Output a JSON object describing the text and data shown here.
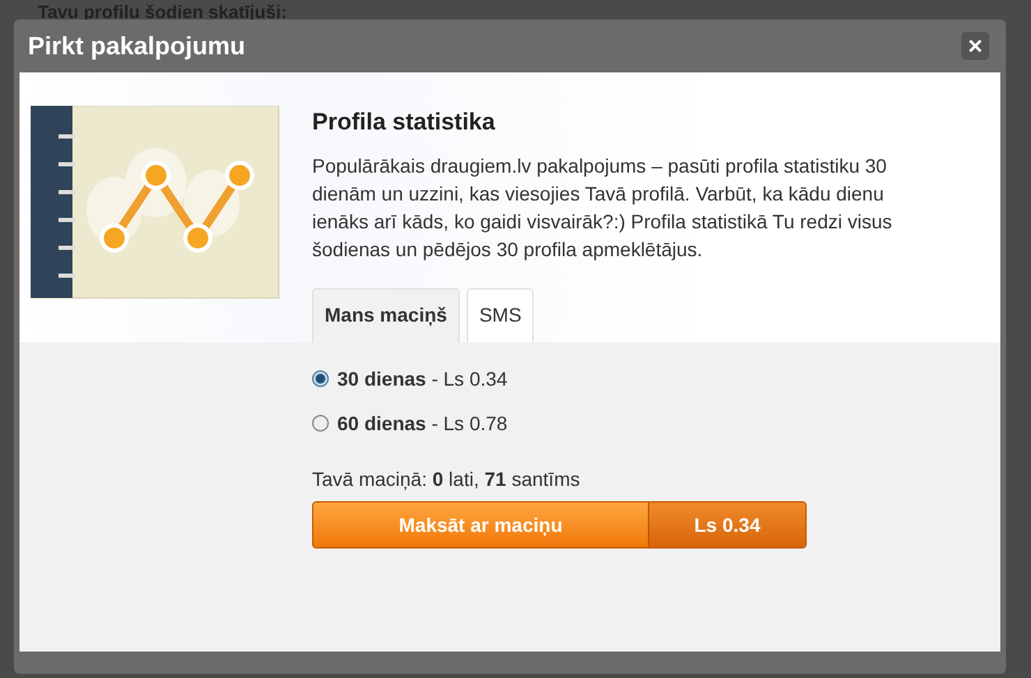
{
  "page": {
    "heading": "Tavu profilu šodien skatījuši:"
  },
  "dialog": {
    "title": "Pirkt pakalpojumu",
    "close": "×",
    "product": {
      "title": "Profila statistika",
      "description": "Populārākais draugiem.lv pakalpojums – pasūti profila statistiku 30 dienām un uzzini, kas viesojies Tavā profilā. Varbūt, ka kādu dienu ienāks arī kāds, ko gaidi visvairāk?:) Profila statistikā Tu redzi visus šodienas un pēdējos 30 profila apmeklētājus."
    },
    "tabs": [
      {
        "label": "Mans maciņš",
        "selected": true
      },
      {
        "label": "SMS",
        "selected": false
      }
    ],
    "options": [
      {
        "label": "**30 dienas** - Ls 0.34",
        "selected": true
      },
      {
        "label": "**60 dienas** - Ls 0.78",
        "selected": false
      }
    ],
    "balance": "Tavā maciņā: **0** lati, **71** santīms",
    "pay_button": {
      "label": "Maksāt ar maciņu",
      "price": "Ls 0.34"
    }
  }
}
